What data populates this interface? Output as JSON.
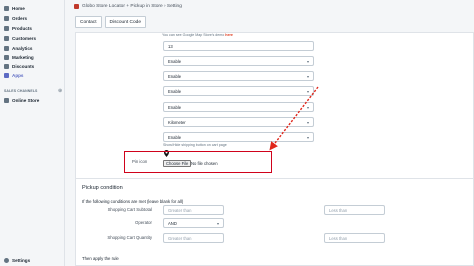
{
  "sidebar": {
    "items": [
      {
        "label": "Home",
        "icon": "home-icon"
      },
      {
        "label": "Orders",
        "icon": "orders-icon"
      },
      {
        "label": "Products",
        "icon": "products-icon"
      },
      {
        "label": "Customers",
        "icon": "customers-icon"
      },
      {
        "label": "Analytics",
        "icon": "analytics-icon"
      },
      {
        "label": "Marketing",
        "icon": "marketing-icon"
      },
      {
        "label": "Discounts",
        "icon": "discounts-icon"
      },
      {
        "label": "Apps",
        "icon": "apps-icon"
      }
    ],
    "section_label": "SALES CHANNELS",
    "online_store": "Online Store",
    "settings": "Settings"
  },
  "header": {
    "title": "Globo Store Locator + Pickup in Store › Setting"
  },
  "tabs": {
    "contact": "Contact",
    "discount": "Discount Code"
  },
  "form": {
    "hint": "You can see Google Map Store's demo",
    "hint_link": "here",
    "zoom_label": "Google maps Zoom level",
    "zoom_value": "13",
    "radius_label": "Filter by radius",
    "radius_value": "Enable",
    "group_label": "Filter by group",
    "group_value": "Enable",
    "tag_label": "Filter by tag",
    "tag_value": "Enable",
    "autodetect_label": "Enable auto detect Location",
    "autodetect_value": "Enable",
    "unit_label": "Distance Length Unit",
    "unit_value": "Kilometer",
    "shipping_label": "Enable Shipping",
    "shipping_value": "Enable",
    "shipping_help": "Show/Hide shipping button on cart page",
    "pin_label": "Pin icon",
    "file_button": "Choose File",
    "file_status": "No file chosen"
  },
  "pickup": {
    "title": "Pickup condition",
    "intro": "If the following conditions are met (leave blank for all)",
    "subtotal_label": "Shopping Cart Subtotal",
    "subtotal_placeholder": "Greater than",
    "subtotal_less": "Less than",
    "operator_label": "Operator",
    "operator_value": "AND",
    "quantity_label": "Shopping Cart Quantity",
    "quantity_placeholder": "Greater than",
    "quantity_less": "Less than",
    "then_label": "Then apply the rule"
  },
  "colors": {
    "highlight": "#d0021b",
    "accent": "#5c6ac4"
  }
}
